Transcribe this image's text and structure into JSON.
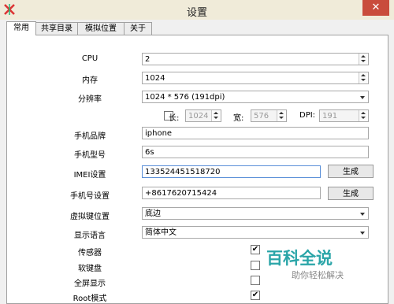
{
  "window": {
    "title": "设置",
    "close_glyph": "✕"
  },
  "tabs": [
    {
      "label": "常用",
      "active": true
    },
    {
      "label": "共享目录",
      "active": false
    },
    {
      "label": "模拟位置",
      "active": false
    },
    {
      "label": "关于",
      "active": false
    }
  ],
  "form": {
    "cpu": {
      "label": "CPU",
      "value": "2"
    },
    "memory": {
      "label": "内存",
      "value": "1024"
    },
    "resolution": {
      "label": "分辨率",
      "value": "1024 * 576 (191dpi)"
    },
    "custom_res": {
      "checked": false,
      "length_label": "长:",
      "length_value": "1024",
      "width_label": "宽:",
      "width_value": "576",
      "dpi_label": "DPI:",
      "dpi_value": "191"
    },
    "brand": {
      "label": "手机品牌",
      "value": "iphone"
    },
    "model": {
      "label": "手机型号",
      "value": "6s"
    },
    "imei": {
      "label": "IMEI设置",
      "value": "133524451518720",
      "button": "生成"
    },
    "phone": {
      "label": "手机号设置",
      "value": "+8617620715424",
      "button": "生成"
    },
    "vkey": {
      "label": "虚拟键位置",
      "value": "底边"
    },
    "language": {
      "label": "显示语言",
      "value": "简体中文"
    },
    "sensor": {
      "label": "传感器",
      "checked": true
    },
    "softkeyboard": {
      "label": "软键盘",
      "checked": false
    },
    "fullscreen": {
      "label": "全屏显示",
      "checked": false
    },
    "root": {
      "label": "Root模式",
      "checked": true
    }
  },
  "watermark": {
    "title": "百科全说",
    "subtitle": "助你轻松解决"
  },
  "colors": {
    "titlebar": "#f0ebd9",
    "close": "#c94c3c",
    "watermark": "#2aa5a8"
  }
}
